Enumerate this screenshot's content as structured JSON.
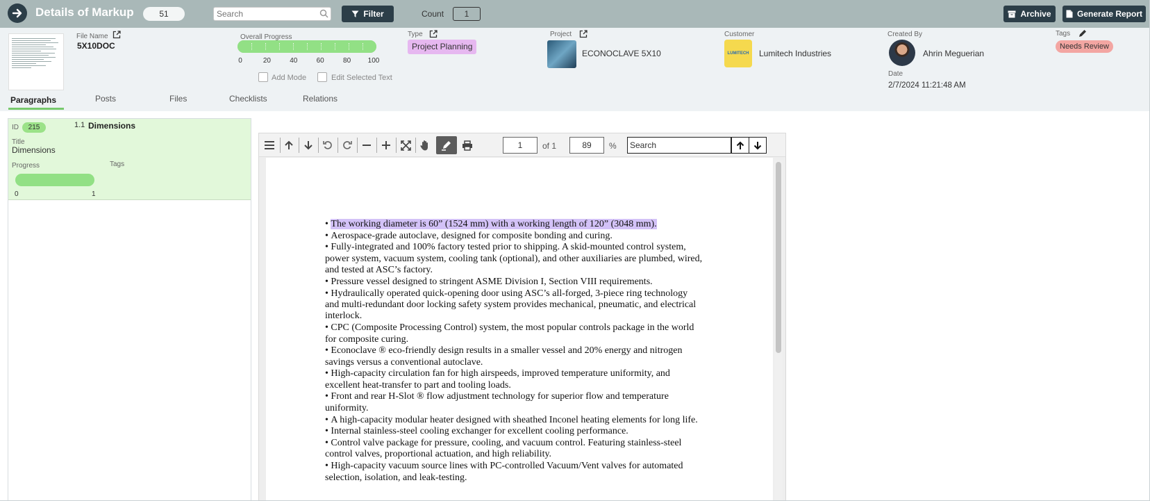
{
  "header": {
    "title": "Details of Markup",
    "count_badge": "51",
    "search_placeholder": "Search",
    "filter_label": "Filter",
    "count_label": "Count",
    "count_value": "1",
    "archive_label": "Archive",
    "report_label": "Generate Report"
  },
  "details": {
    "file_name_label": "File Name",
    "file_name": "5X10DOC",
    "overall_progress_label": "Overall Progress",
    "progress_ticks": [
      "0",
      "20",
      "40",
      "60",
      "80",
      "100"
    ],
    "progress_value_pct": 100,
    "add_mode_label": "Add Mode",
    "edit_selected_label": "Edit Selected Text",
    "type_label": "Type",
    "type_value": "Project Planning",
    "project_label": "Project",
    "project_name": "ECONOCLAVE 5X10",
    "customer_label": "Customer",
    "customer_name": "Lumitech Industries",
    "customer_logo_text": "LUMITECH",
    "created_by_label": "Created By",
    "created_by": "Ahrin Meguerian",
    "date_label": "Date",
    "date": "2/7/2024 11:21:48 AM",
    "tags_label": "Tags",
    "tag": "Needs Review"
  },
  "tabs": [
    "Paragraphs",
    "Posts",
    "Files",
    "Checklists",
    "Relations"
  ],
  "paragraph": {
    "id_label": "ID",
    "id": "215",
    "number": "1.1",
    "heading": "Dimensions",
    "title_label": "Title",
    "title": "Dimensions",
    "progress_label": "Progress",
    "tags_label": "Tags",
    "progress_min": "0",
    "progress_max": "1",
    "progress_value_pct": 100
  },
  "viewer": {
    "page": "1",
    "of_label": "of 1",
    "zoom": "89",
    "pct_label": "%",
    "search_value": "Search"
  },
  "document": {
    "bullets": [
      "The working diameter is 60” (1524 mm) with a working length of 120” (3048 mm).",
      "Aerospace-grade autoclave, designed for composite bonding and curing.",
      "Fully-integrated and 100% factory tested prior to shipping. A skid-mounted control system, power system, vacuum system, cooling tank (optional), and other auxiliaries are plumbed, wired, and tested at ASC’s factory.",
      "Pressure vessel designed to stringent ASME Division I, Section VIII requirements.",
      "Hydraulically operated quick-opening door using ASC’s all-forged, 3-piece ring technology and multi-redundant door locking safety system provides mechanical, pneumatic, and electrical interlock.",
      "CPC (Composite Processing Control) system, the most popular controls package in the world for composite curing.",
      "Econoclave ® eco-friendly design results in a smaller vessel and 20% energy and nitrogen savings versus a conventional autoclave.",
      "High-capacity circulation fan for high airspeeds, improved temperature uniformity, and excellent heat-transfer to part and tooling loads.",
      "Front and rear H-Slot ® flow adjustment technology for superior flow and temperature uniformity.",
      "A high-capacity modular heater designed with sheathed Inconel heating elements for long life.",
      "Internal stainless-steel cooling exchanger for excellent cooling performance.",
      "Control valve package for pressure, cooling, and vacuum control. Featuring stainless-steel control valves, proportional actuation, and high reliability.",
      "High-capacity vacuum source lines with PC-controlled Vacuum/Vent valves for automated selection, isolation, and leak-testing."
    ],
    "bullet_char": "•"
  },
  "colors": {
    "topbar": "#a9b8b8",
    "dark_button": "#2c3e48",
    "progress_green": "#92e085",
    "highlight": "#d3c2f7",
    "type_badge": "#e6b8f0",
    "tag_badge": "#f3a6a2"
  },
  "icons": {
    "back": "arrow-right-icon",
    "search": "search-icon",
    "filter": "filter-icon",
    "archive": "archive-icon",
    "report": "document-icon",
    "edit": "edit-square-icon",
    "pencil": "pencil-icon"
  }
}
